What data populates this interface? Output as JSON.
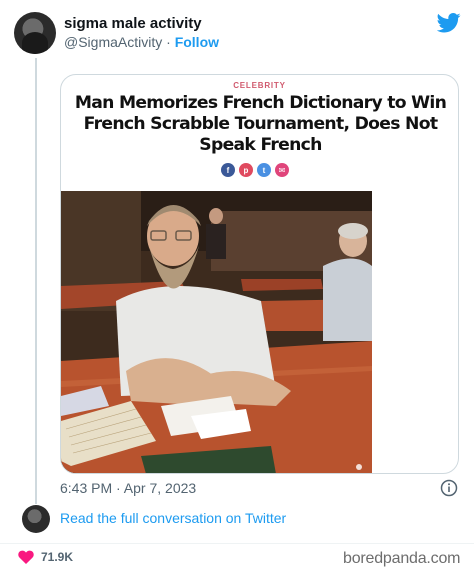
{
  "author": {
    "name": "sigma male activity",
    "handle": "@SigmaActivity",
    "separator": "·",
    "follow_label": "Follow"
  },
  "card": {
    "category": "CELEBRITY",
    "headline": "Man Memorizes French Dictionary to Win French Scrabble Tournament, Does Not Speak French",
    "share_buttons": [
      {
        "icon": "facebook-icon",
        "glyph": "f",
        "color": "#3b5998"
      },
      {
        "icon": "pinterest-icon",
        "glyph": "p",
        "color": "#e04a5f"
      },
      {
        "icon": "twitter-icon",
        "glyph": "t",
        "color": "#4a90e2"
      },
      {
        "icon": "email-icon",
        "glyph": "✉",
        "color": "#e0457b"
      }
    ]
  },
  "tweet": {
    "timestamp": "6:43 PM · Apr 7, 2023",
    "conversation_link": "Read the full conversation on Twitter",
    "likes": "71.9K"
  },
  "watermark": "boredpanda.com",
  "colors": {
    "twitter_blue": "#1d9bf0",
    "heart": "#f91880",
    "muted": "#536471"
  }
}
